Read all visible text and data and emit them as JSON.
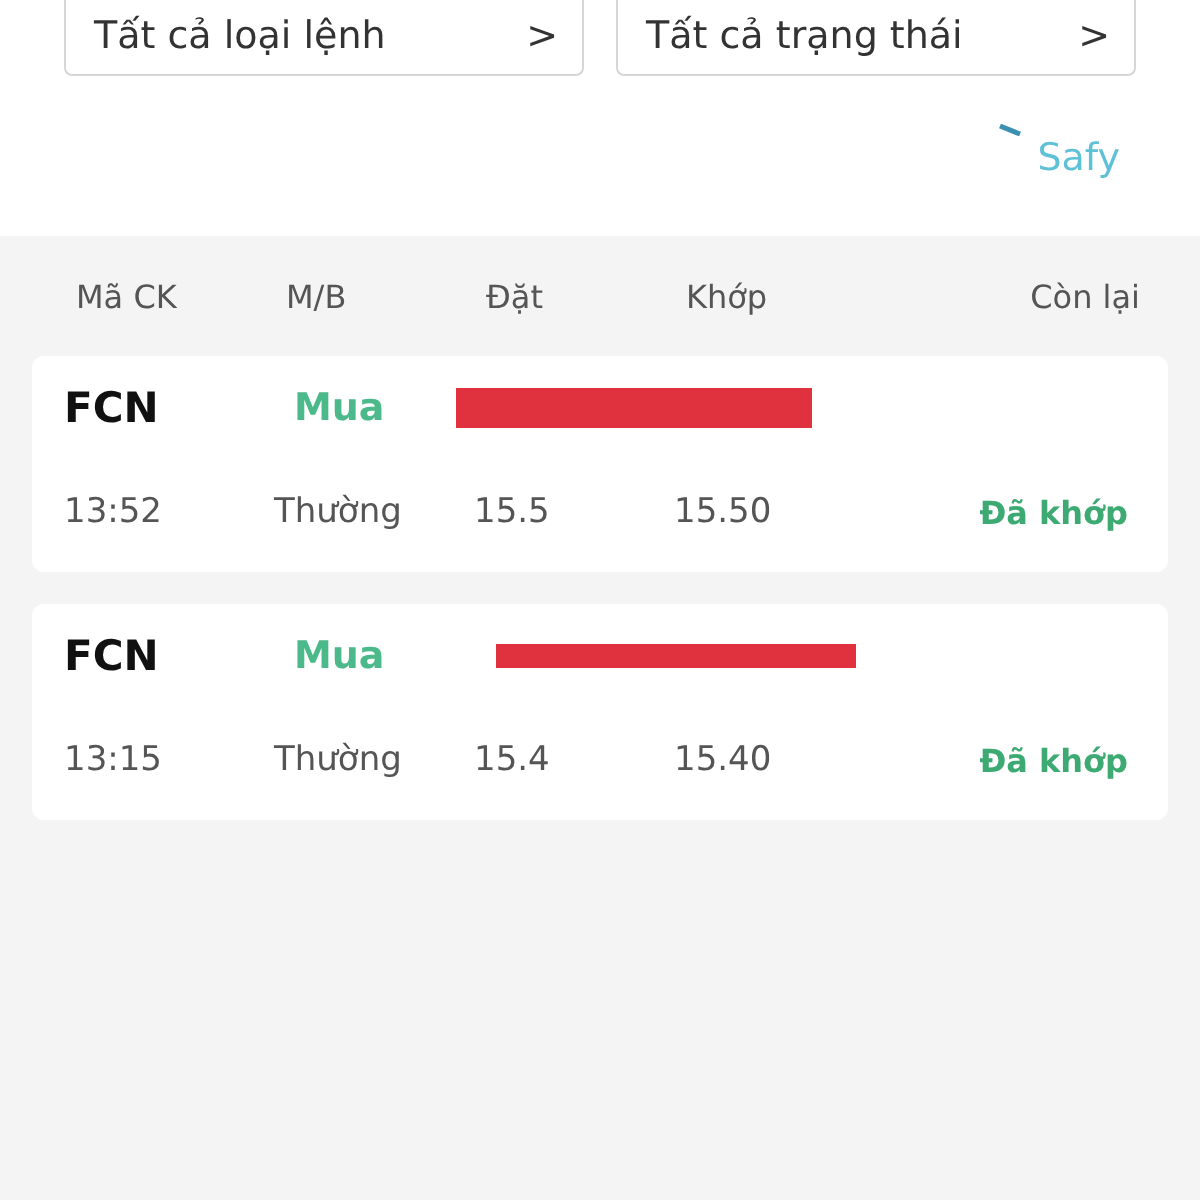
{
  "filters": [
    {
      "label": "Tất cả loại lệnh",
      "chevron": ">"
    },
    {
      "label": "Tất cả trạng thái",
      "chevron": ">"
    }
  ],
  "brand": {
    "name": "Safy"
  },
  "table": {
    "columns": [
      "Mã CK",
      "M/B",
      "Đặt",
      "Khớp",
      "Còn lại"
    ],
    "orders": [
      {
        "symbol": "FCN",
        "side": "Mua",
        "time": "13:52",
        "type": "Thường",
        "price": "15.5",
        "matched": "15.50",
        "status": "Đã khớp",
        "redacted": true
      },
      {
        "symbol": "FCN",
        "side": "Mua",
        "time": "13:15",
        "type": "Thường",
        "price": "15.4",
        "matched": "15.40",
        "status": "Đã khớp",
        "redacted": true
      }
    ]
  }
}
